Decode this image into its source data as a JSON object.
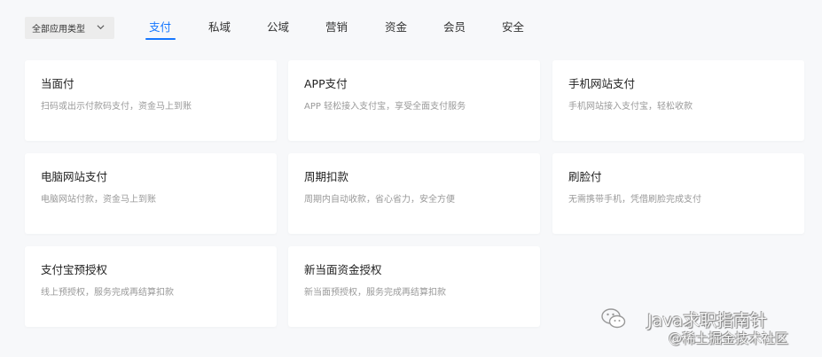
{
  "filter": {
    "label": "全部应用类型"
  },
  "tabs": [
    {
      "label": "支付",
      "active": true
    },
    {
      "label": "私域",
      "active": false
    },
    {
      "label": "公域",
      "active": false
    },
    {
      "label": "营销",
      "active": false
    },
    {
      "label": "资金",
      "active": false
    },
    {
      "label": "会员",
      "active": false
    },
    {
      "label": "安全",
      "active": false
    }
  ],
  "cards": [
    {
      "title": "当面付",
      "desc": "扫码或出示付款码支付，资金马上到账"
    },
    {
      "title": "APP支付",
      "desc": "APP 轻松接入支付宝，享受全面支付服务"
    },
    {
      "title": "手机网站支付",
      "desc": "手机网站接入支付宝，轻松收款"
    },
    {
      "title": "电脑网站支付",
      "desc": "电脑网站付款，资金马上到账"
    },
    {
      "title": "周期扣款",
      "desc": "周期内自动收款，省心省力，安全方便"
    },
    {
      "title": "刷脸付",
      "desc": "无需携带手机，凭借刷脸完成支付"
    },
    {
      "title": "支付宝预授权",
      "desc": "线上预授权，服务完成再结算扣款"
    },
    {
      "title": "新当面资金授权",
      "desc": "新当面预授权，服务完成再结算扣款"
    }
  ],
  "watermark": {
    "line1": "Java求职指南针",
    "line2": "@稀土掘金技术社区",
    "icon": "wechat-icon"
  },
  "colors": {
    "accent": "#1677ff",
    "background": "#f7f8fa",
    "card": "#ffffff"
  }
}
